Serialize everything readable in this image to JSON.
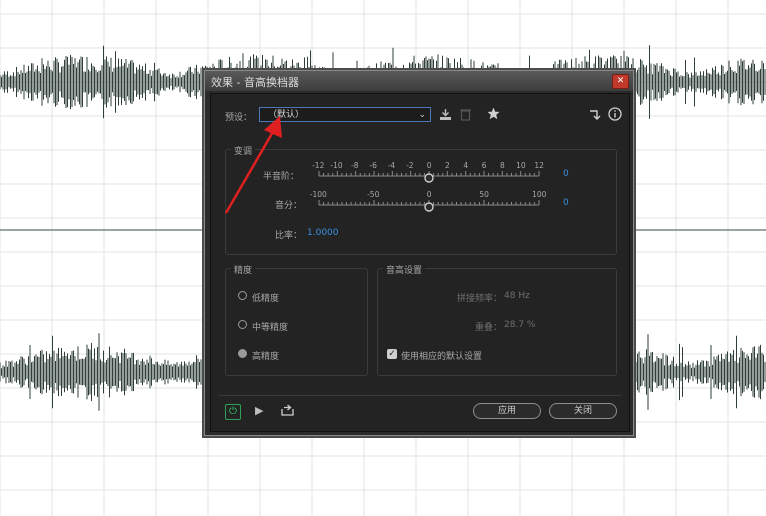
{
  "dialog": {
    "title": "效果 - 音高换档器",
    "close_glyph": "✕",
    "preset_label": "预设：",
    "preset_value": "（默认）",
    "chev": "⌄",
    "icons": {
      "download": "download-icon",
      "delete": "trash-icon",
      "favorite": "star-icon",
      "routing": "routing-icon",
      "info": "info-icon"
    },
    "transpose": {
      "section_label": "变调",
      "semitone_label": "半音阶：",
      "semitone_ticks": [
        "-12",
        "-10",
        "-8",
        "-6",
        "-4",
        "-2",
        "0",
        "2",
        "4",
        "6",
        "8",
        "10",
        "12"
      ],
      "semitone_value": "0",
      "cents_label": "音分：",
      "cents_ticks": [
        "-100",
        "-50",
        "0",
        "50",
        "100"
      ],
      "cents_value": "0",
      "ratio_label": "比率：",
      "ratio_value": "1.0000"
    },
    "precision": {
      "section_label": "精度",
      "options": [
        "低精度",
        "中等精度",
        "高精度"
      ],
      "selected_index": 2
    },
    "pitch_settings": {
      "section_label": "音高设置",
      "splice_label": "拼接频率：",
      "splice_value": "48 Hz",
      "overlap_label": "重叠：",
      "overlap_value": "28.7 %",
      "default_label": "使用相应的默认设置",
      "default_checked": true
    },
    "footer": {
      "apply_label": "应用",
      "close_label": "关闭",
      "power_glyph": "⏻",
      "play_glyph": "▶",
      "loop_glyph": "⇥"
    }
  },
  "colors": {
    "accent_blue": "#3a8fe0",
    "annotation_red": "#e02020",
    "wave": "#2f3f38"
  }
}
